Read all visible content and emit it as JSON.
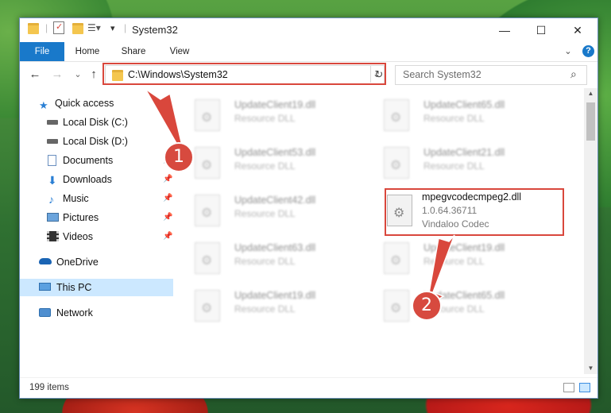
{
  "window": {
    "title": "System32",
    "minimize_glyph": "—",
    "maximize_glyph": "☐",
    "close_glyph": "✕"
  },
  "ribbon": {
    "tabs": [
      "File",
      "Home",
      "Share",
      "View"
    ],
    "expand_glyph": "⌄",
    "help_glyph": "?"
  },
  "nav": {
    "back_glyph": "←",
    "forward_glyph": "→",
    "recent_glyph": "⌄",
    "up_glyph": "↑",
    "address": "C:\\Windows\\System32",
    "address_dropdown_glyph": "⌄",
    "refresh_glyph": "↻",
    "search_placeholder": "Search System32",
    "search_glyph": "⌕"
  },
  "sidebar": {
    "items": [
      {
        "label": "Quick access",
        "icon": "star-icon",
        "pinned": false
      },
      {
        "label": "Local Disk (C:)",
        "icon": "drive-icon",
        "pinned": false
      },
      {
        "label": "Local Disk (D:)",
        "icon": "drive-icon",
        "pinned": false
      },
      {
        "label": "Documents",
        "icon": "document-icon",
        "pinned": true
      },
      {
        "label": "Downloads",
        "icon": "download-icon",
        "pinned": true
      },
      {
        "label": "Music",
        "icon": "music-icon",
        "pinned": true
      },
      {
        "label": "Pictures",
        "icon": "picture-icon",
        "pinned": true
      },
      {
        "label": "Videos",
        "icon": "video-icon",
        "pinned": true
      },
      {
        "label": "OneDrive",
        "icon": "cloud-icon",
        "pinned": false
      },
      {
        "label": "This PC",
        "icon": "computer-icon",
        "pinned": false,
        "selected": true
      },
      {
        "label": "Network",
        "icon": "network-icon",
        "pinned": false
      }
    ]
  },
  "files": [
    {
      "name": "UpdateClient19.dll",
      "type": "Resource DLL"
    },
    {
      "name": "UpdateClient65.dll",
      "type": "Resource DLL"
    },
    {
      "name": "UpdateClient53.dll",
      "type": "Resource DLL"
    },
    {
      "name": "UpdateClient21.dll",
      "type": "Resource DLL"
    },
    {
      "name": "UpdateClient42.dll",
      "type": "Resource DLL"
    },
    {
      "name": "mpegvcodecmpeg2.dll",
      "version": "1.0.64.36711",
      "type": "Vindaloo Codec",
      "highlighted": true
    },
    {
      "name": "UpdateClient63.dll",
      "type": "Resource DLL"
    },
    {
      "name": "UpdateClient19.dll",
      "type": "Resource DLL"
    },
    {
      "name": "UpdateClient19.dll",
      "type": "Resource DLL"
    },
    {
      "name": "UpdateClient65.dll",
      "type": "Resource DLL"
    }
  ],
  "status": {
    "item_count": "199 items"
  },
  "annotations": {
    "step1": "1",
    "step2": "2",
    "color": "#d9473c"
  },
  "colors": {
    "accent": "#1979ca",
    "selection": "#cce8ff",
    "highlight": "#d9473c"
  }
}
